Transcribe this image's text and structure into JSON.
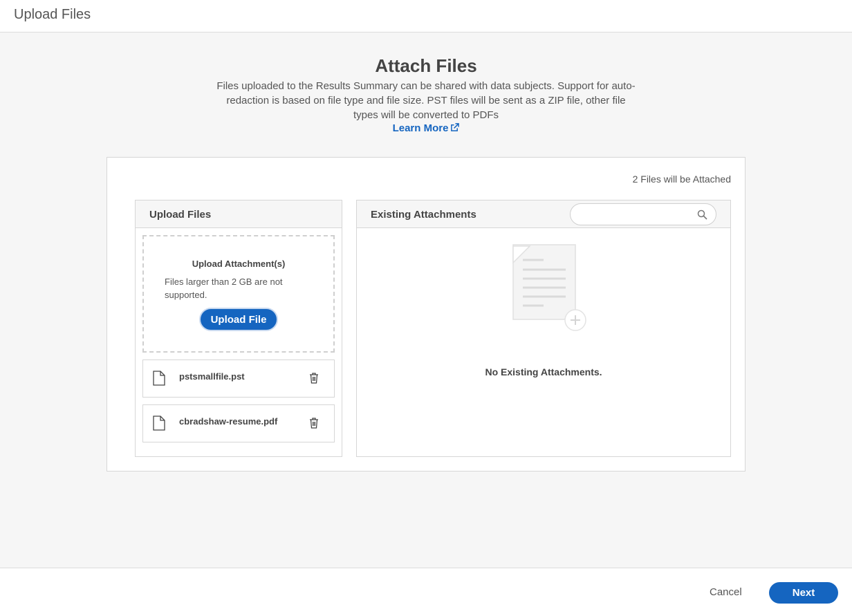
{
  "window": {
    "title": "Upload Files"
  },
  "intro": {
    "heading": "Attach Files",
    "description": "Files uploaded to the Results Summary can be shared with data subjects. Support for auto-redaction is based on file type and file size. PST files will be sent as a ZIP file, other file types will be converted to PDFs",
    "learn_more": "Learn More"
  },
  "summary": {
    "files_count_text": "2 Files will be Attached"
  },
  "upload_panel": {
    "title": "Upload Files",
    "dropzone_title": "Upload Attachment(s)",
    "dropzone_note": "Files larger than 2 GB are not supported.",
    "upload_button": "Upload File",
    "files": [
      {
        "name": "pstsmallfile.pst",
        "icon": "file-icon",
        "action_icon": "trash-icon"
      },
      {
        "name": "cbradshaw-resume.pdf",
        "icon": "file-icon",
        "action_icon": "trash-icon"
      }
    ]
  },
  "existing_panel": {
    "title": "Existing Attachments",
    "search_placeholder": "",
    "search_icon": "search-icon",
    "empty_text": "No Existing Attachments."
  },
  "footer": {
    "cancel": "Cancel",
    "next": "Next"
  },
  "colors": {
    "accent": "#1565c0",
    "background": "#f6f6f6",
    "border": "#d6d6d6"
  }
}
